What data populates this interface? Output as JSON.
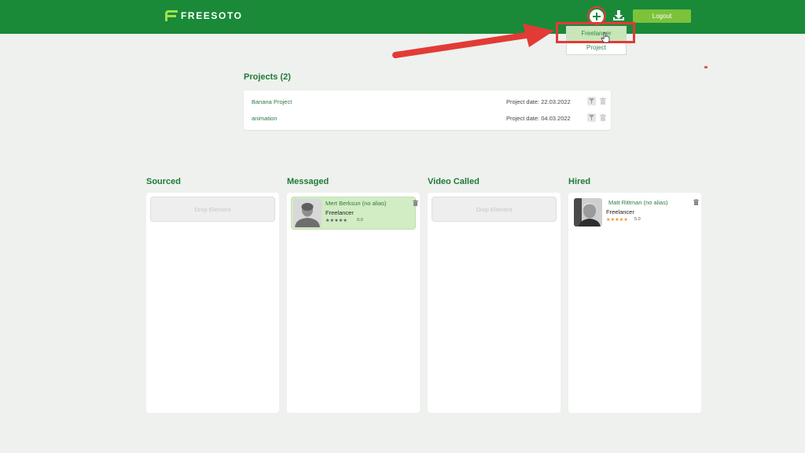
{
  "header": {
    "logo_text": "FREESOTO",
    "add_icon": "plus-circle-icon",
    "download_icon": "download-icon",
    "logout_label": "Logout",
    "brand_color": "#1a8a39",
    "accent_color": "#7cc23a"
  },
  "dropdown": {
    "items": [
      {
        "label": "Freelancer"
      },
      {
        "label": "Project"
      }
    ]
  },
  "projects": {
    "title": "Projects (2)",
    "rows": [
      {
        "name": "Banana Project",
        "date": "Project date: 22.03.2022"
      },
      {
        "name": "animation",
        "date": "Project date: 04.03.2022"
      }
    ]
  },
  "pipeline": {
    "columns": [
      {
        "title": "Sourced",
        "drop_label": "Drop Element"
      },
      {
        "title": "Messaged",
        "card": {
          "name": "Mert Berksun (no alias)",
          "role": "Freelancer",
          "rating": "0.0",
          "stars": 0
        }
      },
      {
        "title": "Video Called",
        "drop_label": "Drop Element"
      },
      {
        "title": "Hired",
        "card": {
          "name": "Matt Rittman (no alias)",
          "role": "Freelancer",
          "rating": "5.0",
          "stars": 5
        }
      }
    ]
  },
  "annotation_color": "#e23b36"
}
